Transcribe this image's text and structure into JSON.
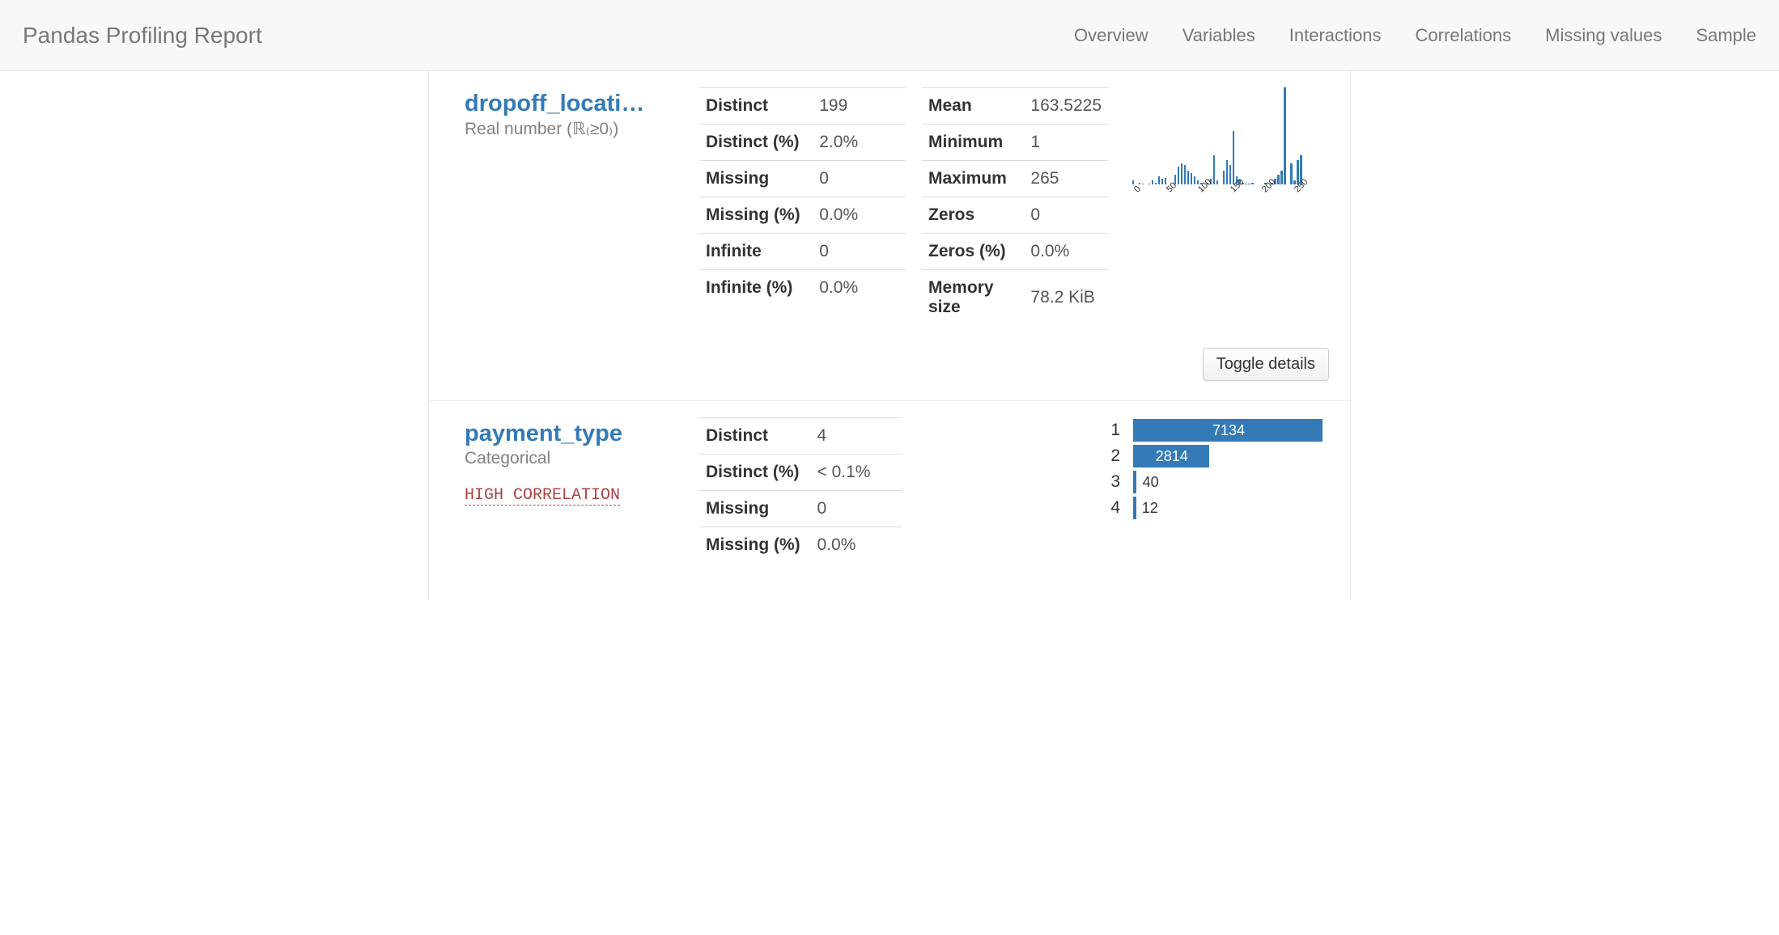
{
  "navbar": {
    "brand": "Pandas Profiling Report",
    "items": [
      "Overview",
      "Variables",
      "Interactions",
      "Correlations",
      "Missing values",
      "Sample"
    ]
  },
  "var1": {
    "name": "dropoff_locati…",
    "type": "Real number (ℝ₍≥0₎)",
    "stats_a": [
      {
        "label": "Distinct",
        "value": "199"
      },
      {
        "label": "Distinct (%)",
        "value": "2.0%"
      },
      {
        "label": "Missing",
        "value": "0"
      },
      {
        "label": "Missing (%)",
        "value": "0.0%"
      },
      {
        "label": "Infinite",
        "value": "0"
      },
      {
        "label": "Infinite (%)",
        "value": "0.0%"
      }
    ],
    "stats_b": [
      {
        "label": "Mean",
        "value": "163.5225"
      },
      {
        "label": "Minimum",
        "value": "1"
      },
      {
        "label": "Maximum",
        "value": "265"
      },
      {
        "label": "Zeros",
        "value": "0"
      },
      {
        "label": "Zeros (%)",
        "value": "0.0%"
      },
      {
        "label": "Memory size",
        "value": "78.2 KiB"
      }
    ],
    "toggle": "Toggle details"
  },
  "var2": {
    "name": "payment_type",
    "type": "Categorical",
    "warn": "HIGH CORRELATION",
    "stats": [
      {
        "label": "Distinct",
        "value": "4"
      },
      {
        "label": "Distinct (%)",
        "value": "< 0.1%"
      },
      {
        "label": "Missing",
        "value": "0"
      },
      {
        "label": "Missing (%)",
        "value": "0.0%"
      }
    ],
    "freq": [
      {
        "cat": "1",
        "count": 7134
      },
      {
        "cat": "2",
        "count": 2814
      },
      {
        "cat": "3",
        "count": 40
      },
      {
        "cat": "4",
        "count": 12
      }
    ]
  },
  "chart_data": {
    "type": "bar",
    "title": "",
    "xlabel": "",
    "ylabel": "",
    "xlim": [
      0,
      265
    ],
    "x_ticks": [
      0,
      50,
      100,
      150,
      200,
      250
    ],
    "bin_width": 5,
    "bins": [
      0,
      5,
      10,
      15,
      20,
      25,
      30,
      35,
      40,
      45,
      50,
      55,
      60,
      65,
      70,
      75,
      80,
      85,
      90,
      95,
      100,
      105,
      110,
      115,
      120,
      125,
      130,
      135,
      140,
      145,
      150,
      155,
      160,
      165,
      170,
      175,
      180,
      185,
      190,
      195,
      200,
      205,
      210,
      215,
      220,
      225,
      230,
      235,
      240,
      245,
      250,
      255,
      260,
      265
    ],
    "values": [
      4,
      0,
      2,
      1,
      0,
      1,
      4,
      2,
      8,
      6,
      7,
      0,
      0,
      10,
      18,
      22,
      20,
      14,
      12,
      8,
      4,
      2,
      0,
      2,
      6,
      30,
      4,
      0,
      14,
      25,
      20,
      55,
      8,
      5,
      2,
      1,
      1,
      2,
      0,
      0,
      0,
      2,
      0,
      2,
      6,
      10,
      14,
      100,
      0,
      22,
      4,
      25,
      30
    ]
  }
}
